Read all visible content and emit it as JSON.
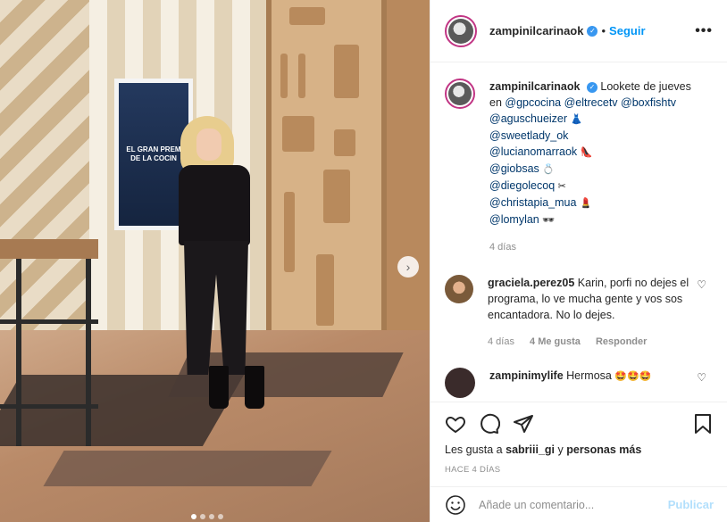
{
  "header": {
    "username": "zampinilcarinaok",
    "separator": "•",
    "follow_label": "Seguir",
    "more_label": "•••"
  },
  "photo": {
    "screen_line1": "EL GRAN PREM",
    "screen_line2": "DE LA COCIN",
    "next_label": "›"
  },
  "caption": {
    "username": "zampinilcarinaok",
    "text_intro": "Lookete de jueves en",
    "mentions": [
      "@gpcocina",
      "@eltrecetv",
      "@boxfishtv",
      "@aguschueizer",
      "@sweetlady_ok",
      "@lucianomarraok",
      "@giobsas",
      "@diegolecoq",
      "@christapia_mua",
      "@lomylan"
    ],
    "emojis": [
      "👗",
      "👠",
      "💍",
      "✂",
      "💄",
      "🕶"
    ],
    "time": "4 días"
  },
  "comment1": {
    "username": "graciela.perez05",
    "text": "Karin, porfi no dejes el programa, lo ve mucha gente y vos sos encantadora. No lo dejes.",
    "time": "4 días",
    "likes": "4 Me gusta",
    "reply": "Responder"
  },
  "comment2": {
    "username": "zampinimylife",
    "text": "Hermosa",
    "emojis": "🤩🤩🤩"
  },
  "actions": {
    "likes_prefix": "Les gusta a",
    "likes_user": "sabriii_gi",
    "likes_mid": "y",
    "likes_suffix": "personas más",
    "time_ago": "HACE 4 DÍAS"
  },
  "add_comment": {
    "placeholder": "Añade un comentario...",
    "publish_label": "Publicar"
  },
  "colors": {
    "link": "#00376b",
    "follow": "#0095f6",
    "verified": "#3897f0",
    "publish_disabled": "#b2dffc",
    "muted": "#8e8e8e"
  }
}
